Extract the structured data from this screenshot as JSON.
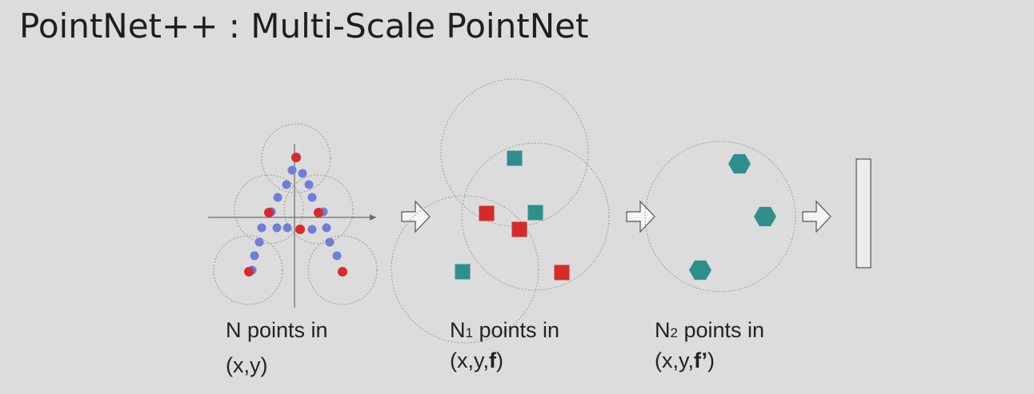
{
  "title": "PointNet++ : Multi-Scale PointNet",
  "stages": [
    {
      "line1_pre": "N",
      "line1_sub": "",
      "line1_post": " points in",
      "line2_pre": "(x,y)",
      "line2_bold": "",
      "line2_post": ""
    },
    {
      "line1_pre": "N",
      "line1_sub": "1",
      "line1_post": " points in",
      "line2_pre": "(x,y,",
      "line2_bold": "f",
      "line2_post": ")"
    },
    {
      "line1_pre": "N",
      "line1_sub": "2",
      "line1_post": " points in",
      "line2_pre": "(x,y,",
      "line2_bold": "f’",
      "line2_post": ")"
    }
  ],
  "colors": {
    "background": "#dcdcdc",
    "blue_point": "#6f7fd6",
    "red_point": "#d52b2b",
    "teal": "#2f8f8c",
    "circle": "#9a9a9a",
    "axis": "#6b6b6b"
  }
}
